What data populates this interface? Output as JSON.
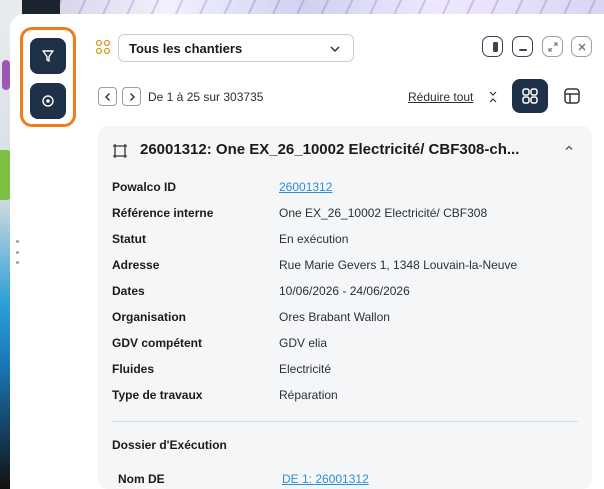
{
  "header": {
    "select_value": "Tous les chantiers"
  },
  "pagination": {
    "range_text": "De 1 à 25 sur 303735",
    "collapse_label": "Réduire tout"
  },
  "card": {
    "title": "26001312: One EX_26_10002 Electricité/ CBF308-ch...",
    "fields": [
      {
        "label": "Powalco ID",
        "value": "26001312"
      },
      {
        "label": "Référence interne",
        "value": "One EX_26_10002 Electricité/ CBF308"
      },
      {
        "label": "Statut",
        "value": "En exécution"
      },
      {
        "label": "Adresse",
        "value": "Rue Marie Gevers 1, 1348 Louvain-la-Neuve"
      },
      {
        "label": "Dates",
        "value": "10/06/2026 - 24/06/2026"
      },
      {
        "label": "Organisation",
        "value": "Ores Brabant Wallon"
      },
      {
        "label": "GDV compétent",
        "value": "GDV elia"
      },
      {
        "label": "Fluides",
        "value": "Electricité"
      },
      {
        "label": "Type de travaux",
        "value": "Réparation"
      }
    ],
    "section_title": "Dossier d'Exécution",
    "partial_label": "Nom DE",
    "partial_value": "DE 1: 26001312"
  },
  "colors": {
    "accent_orange": "#f07c1a",
    "navy": "#1f3049",
    "link_blue": "#2a8fd6"
  },
  "icons": [
    "filter-icon",
    "target-icon",
    "grid-icon",
    "chevron-down-icon",
    "sidebar-toggle-icon",
    "minimize-icon",
    "expand-icon",
    "close-icon",
    "chevron-left-icon",
    "chevron-right-icon",
    "collapse-all-icon",
    "grid-view-icon",
    "table-view-icon",
    "map-frame-icon",
    "chevron-up-icon"
  ]
}
